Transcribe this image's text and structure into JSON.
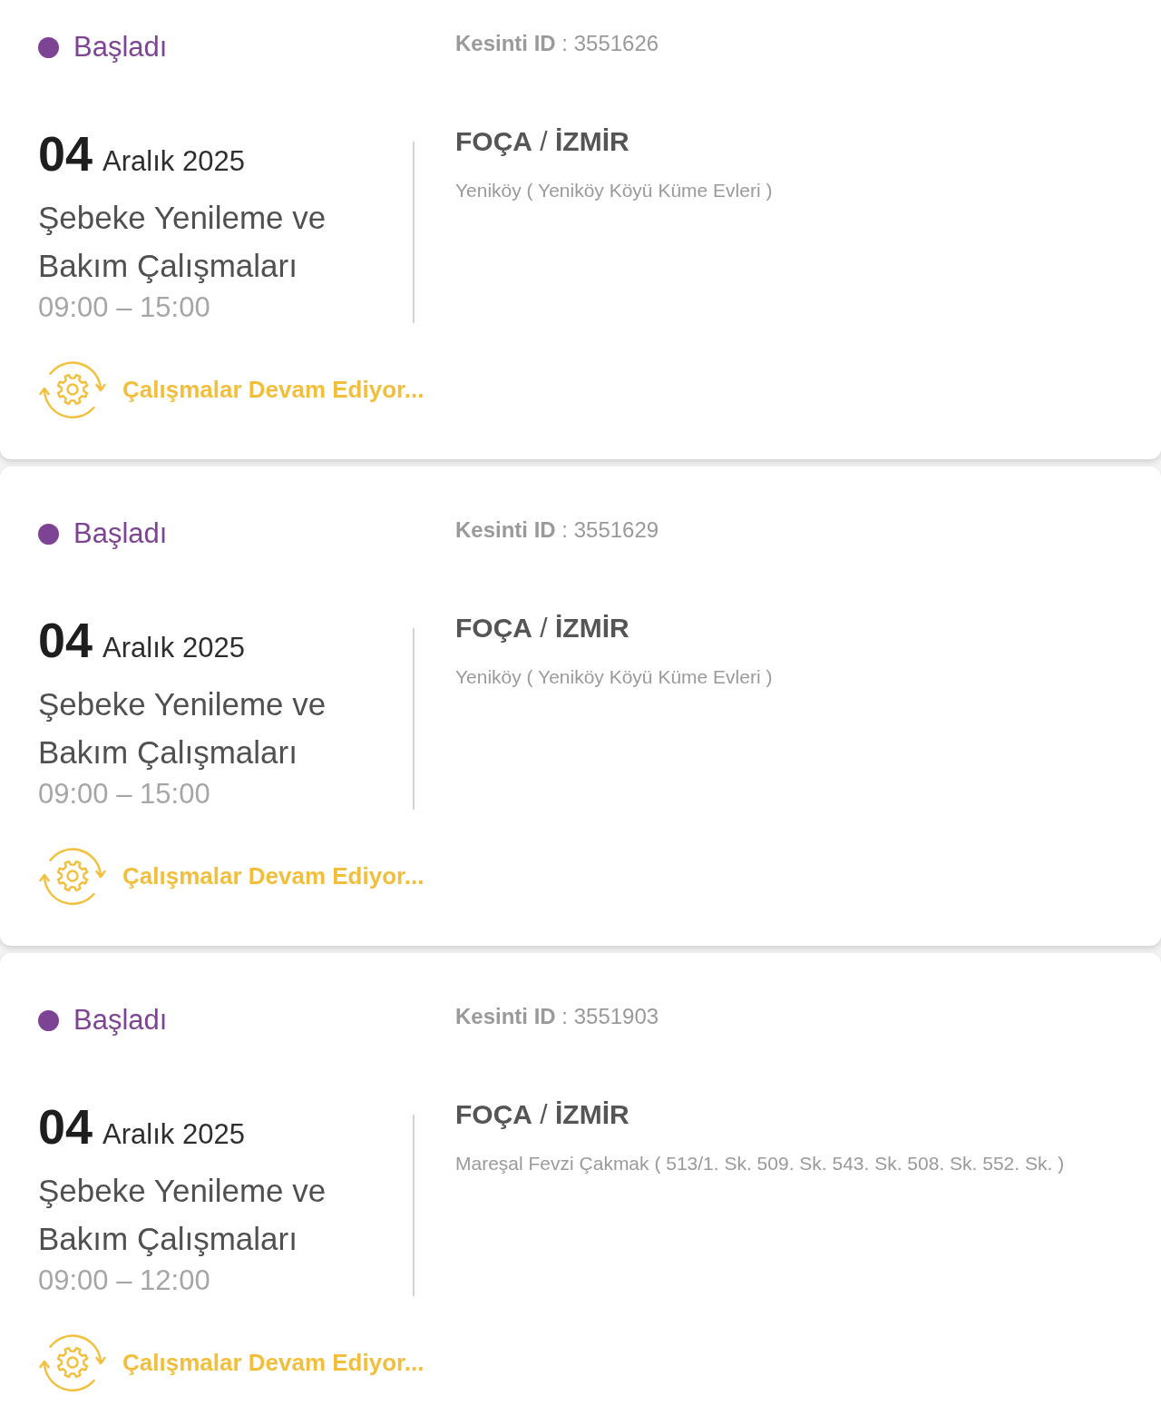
{
  "outages": [
    {
      "status": {
        "label": "Başladı",
        "color": "#7e4494"
      },
      "outage_id": "**Kesinti ID** : 3551626",
      "day": "04",
      "month_year": "Aralık 2025",
      "title": "Şebeke Yenileme ve Bakım Çalışmaları",
      "time": "09:00 – 15:00",
      "location": "**FOÇA** / **İZMİR**",
      "address": "Yeniköy ( Yeniköy Köyü Küme Evleri )",
      "progress": "Çalışmalar Devam Ediyor..."
    },
    {
      "status": {
        "label": "Başladı",
        "color": "#7e4494"
      },
      "outage_id": "**Kesinti ID** : 3551629",
      "day": "04",
      "month_year": "Aralık 2025",
      "title": "Şebeke Yenileme ve Bakım Çalışmaları",
      "time": "09:00 – 15:00",
      "location": "**FOÇA** / **İZMİR**",
      "address": "Yeniköy ( Yeniköy Köyü Küme Evleri )",
      "progress": "Çalışmalar Devam Ediyor..."
    },
    {
      "status": {
        "label": "Başladı",
        "color": "#7e4494"
      },
      "outage_id": "**Kesinti ID** : 3551903",
      "day": "04",
      "month_year": "Aralık 2025",
      "title": "Şebeke Yenileme ve Bakım Çalışmaları",
      "time": "09:00 – 12:00",
      "location": "**FOÇA** / **İZMİR**",
      "address": "Mareşal Fevzi Çakmak ( 513/1. Sk. 509. Sk. 543. Sk. 508. Sk. 552. Sk. )",
      "progress": "Çalışmalar Devam Ediyor..."
    }
  ]
}
